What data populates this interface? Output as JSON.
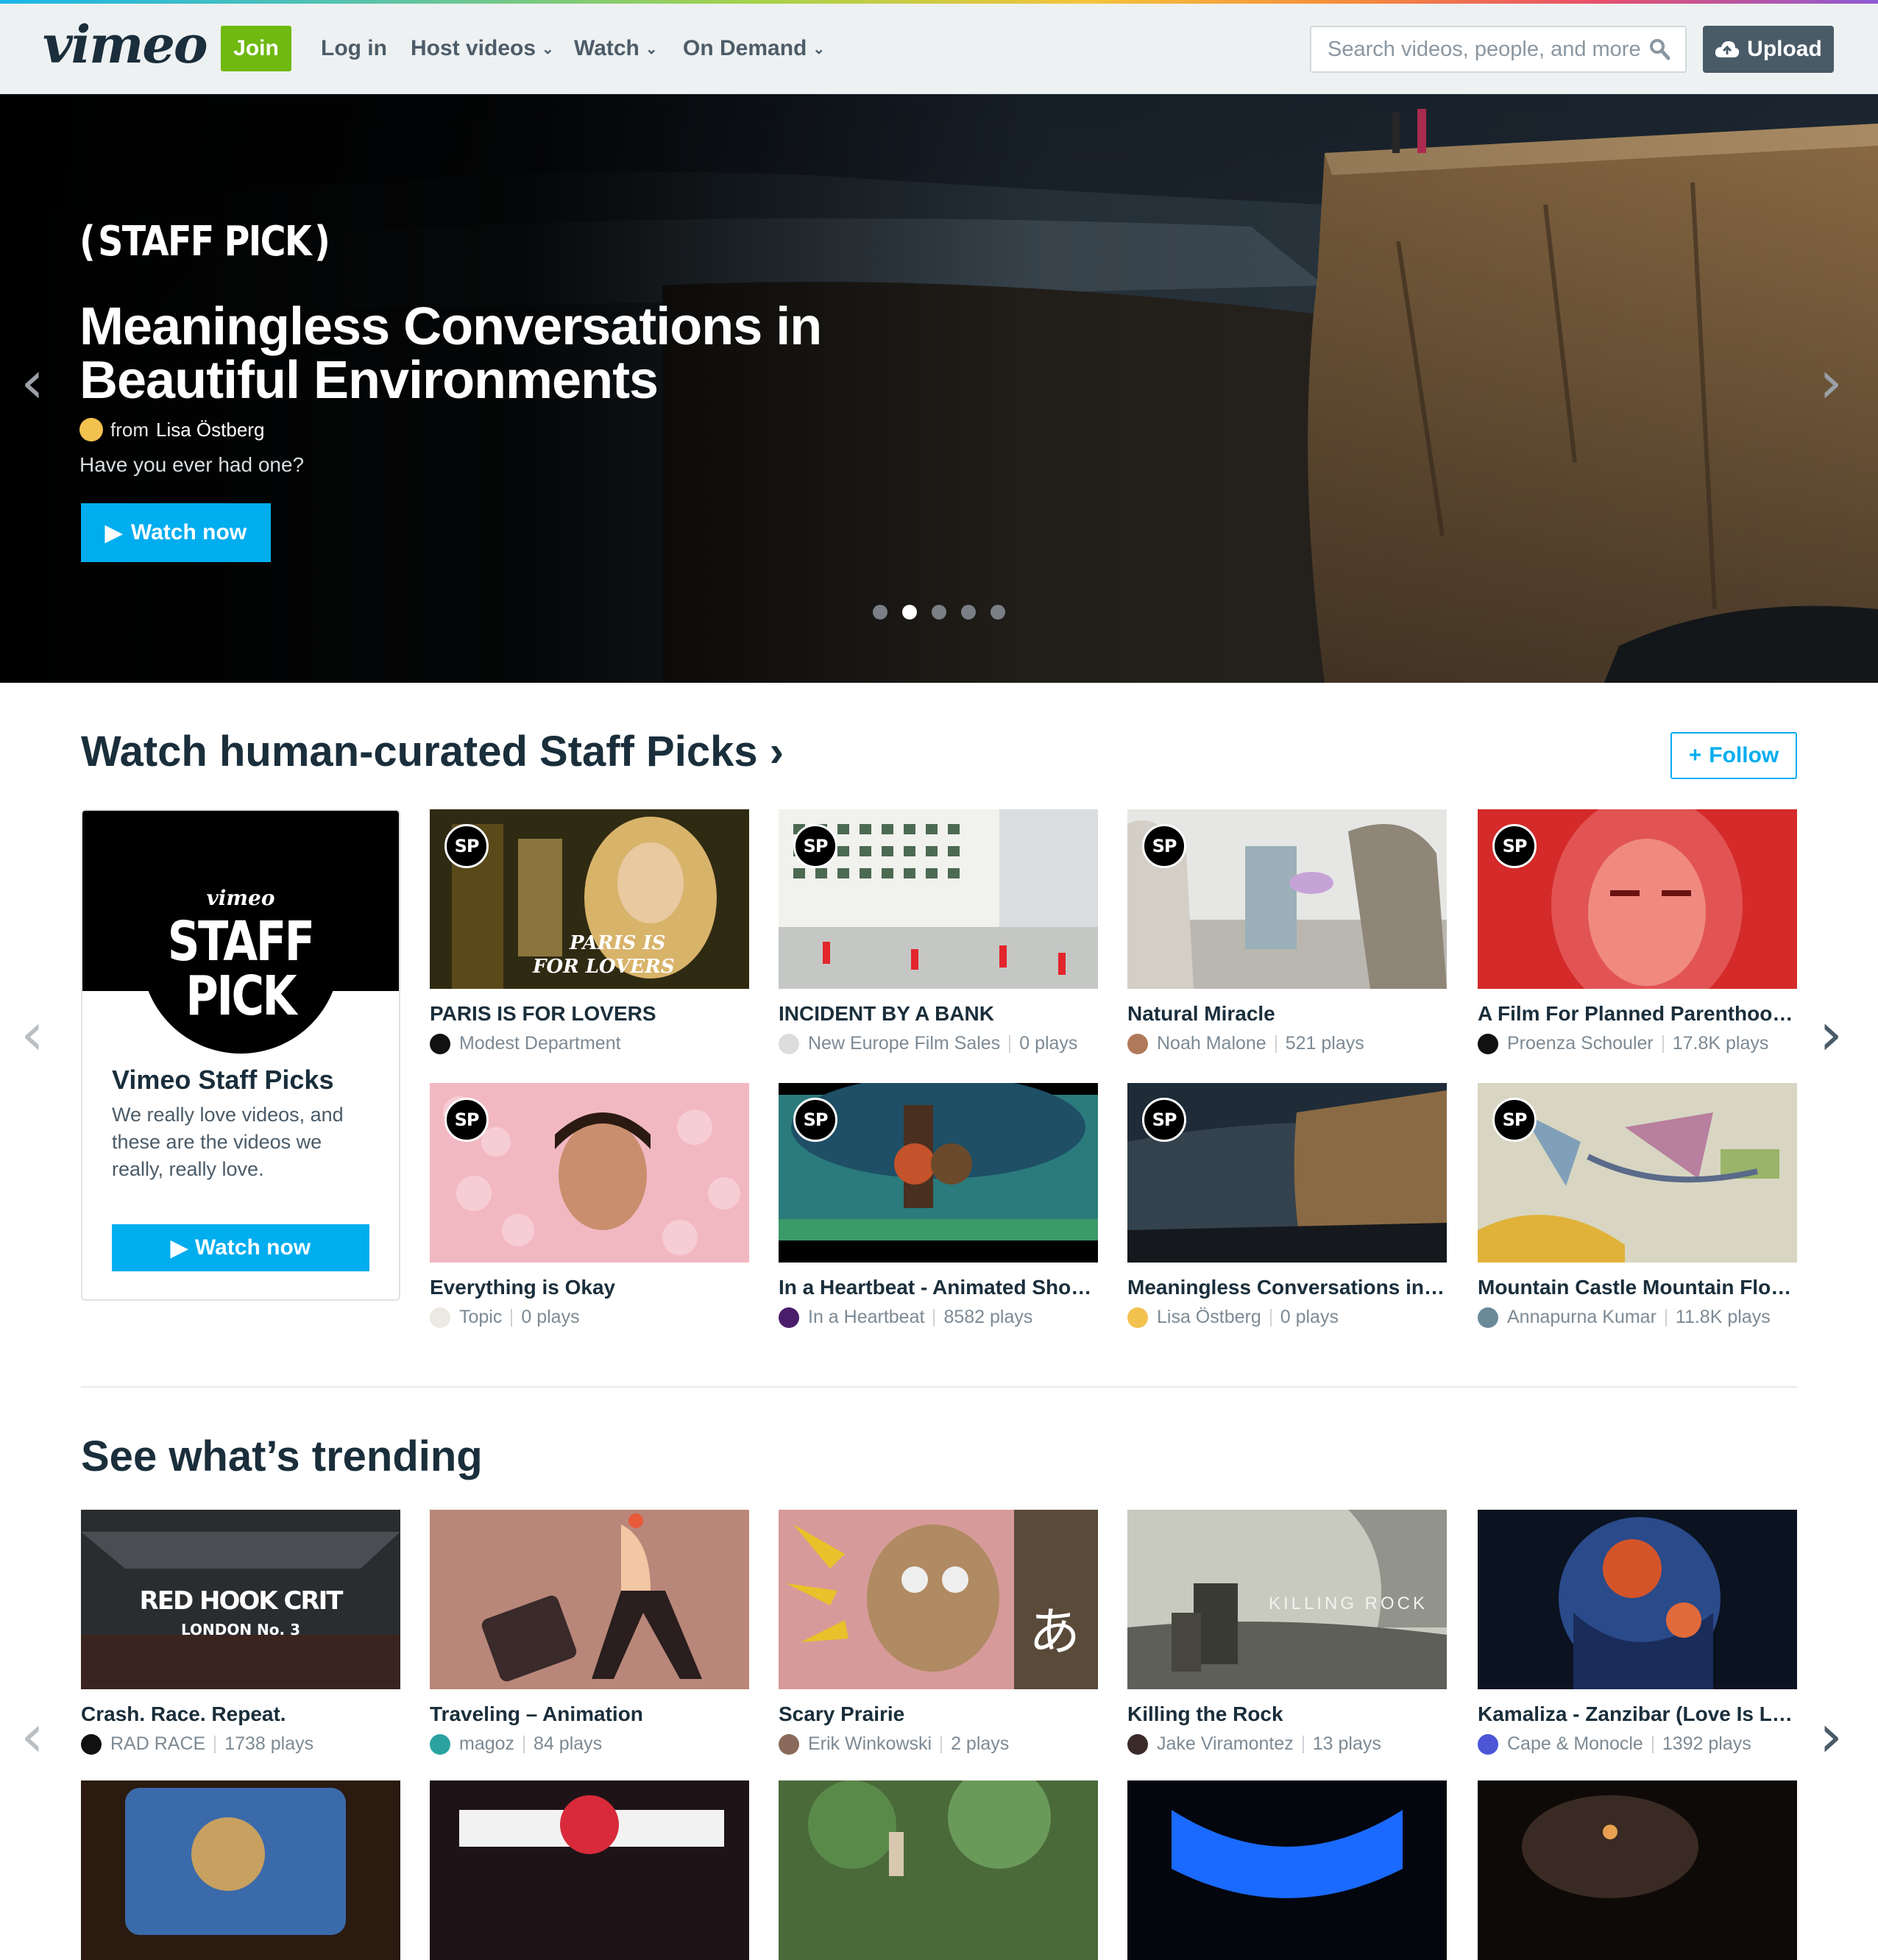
{
  "brand": {
    "logo": "vimeo",
    "accent": "#00adef",
    "join_color": "#6fb911"
  },
  "header": {
    "join_label": "Join",
    "login_label": "Log in",
    "nav": [
      "Host videos",
      "Watch",
      "On Demand"
    ],
    "search_placeholder": "Search videos, people, and more",
    "upload_label": "Upload"
  },
  "hero": {
    "badge": "STAFF PICK",
    "title": "Meaningless Conversations in Beautiful Environments",
    "from_prefix": "from",
    "author": "Lisa Östberg",
    "description": "Have you ever had one?",
    "cta": "Watch now",
    "slides": 5,
    "active_slide": 2
  },
  "staff_picks": {
    "heading": "Watch human-curated Staff Picks ›",
    "follow_label": "Follow",
    "card": {
      "logo": "vimeo",
      "badge_line1": "STAFF",
      "badge_line2": "PICK",
      "name": "Vimeo Staff Picks",
      "description": "We really love videos, and these are the videos we really, really love.",
      "cta": "Watch now"
    },
    "chip": "SP",
    "videos": [
      {
        "title": "PARIS IS FOR LOVERS",
        "author": "Modest Department",
        "plays": ""
      },
      {
        "title": "INCIDENT BY A BANK",
        "author": "New Europe Film Sales",
        "plays": "0 plays"
      },
      {
        "title": "Natural Miracle",
        "author": "Noah Malone",
        "plays": "521 plays"
      },
      {
        "title": "A Film For Planned Parenthood ...",
        "author": "Proenza Schouler",
        "plays": "17.8K plays"
      },
      {
        "title": "Everything is Okay",
        "author": "Topic",
        "plays": "0 plays"
      },
      {
        "title": "In a Heartbeat - Animated Short...",
        "author": "In a Heartbeat",
        "plays": "8582 plays"
      },
      {
        "title": "Meaningless Conversations in B...",
        "author": "Lisa Östberg",
        "plays": "0 plays"
      },
      {
        "title": "Mountain Castle Mountain Flow...",
        "author": "Annapurna Kumar",
        "plays": "11.8K plays"
      }
    ]
  },
  "trending": {
    "heading": "See what’s trending",
    "videos": [
      {
        "title": "Crash. Race. Repeat.",
        "author": "RAD RACE",
        "plays": "1738 plays"
      },
      {
        "title": "Traveling – Animation",
        "author": "magoz",
        "plays": "84 plays"
      },
      {
        "title": "Scary Prairie",
        "author": "Erik Winkowski",
        "plays": "2 plays"
      },
      {
        "title": "Killing the Rock",
        "author": "Jake Viramontez",
        "plays": "13 plays"
      },
      {
        "title": "Kamaliza - Zanzibar (Love Is Lo...",
        "author": "Cape & Monocle",
        "plays": "1392 plays"
      }
    ],
    "thumb_text": {
      "crash_1": "RED HOOK CRIT",
      "crash_2": "LONDON No. 3",
      "scary": "あ",
      "killing": "KILLING   ROCK"
    }
  }
}
